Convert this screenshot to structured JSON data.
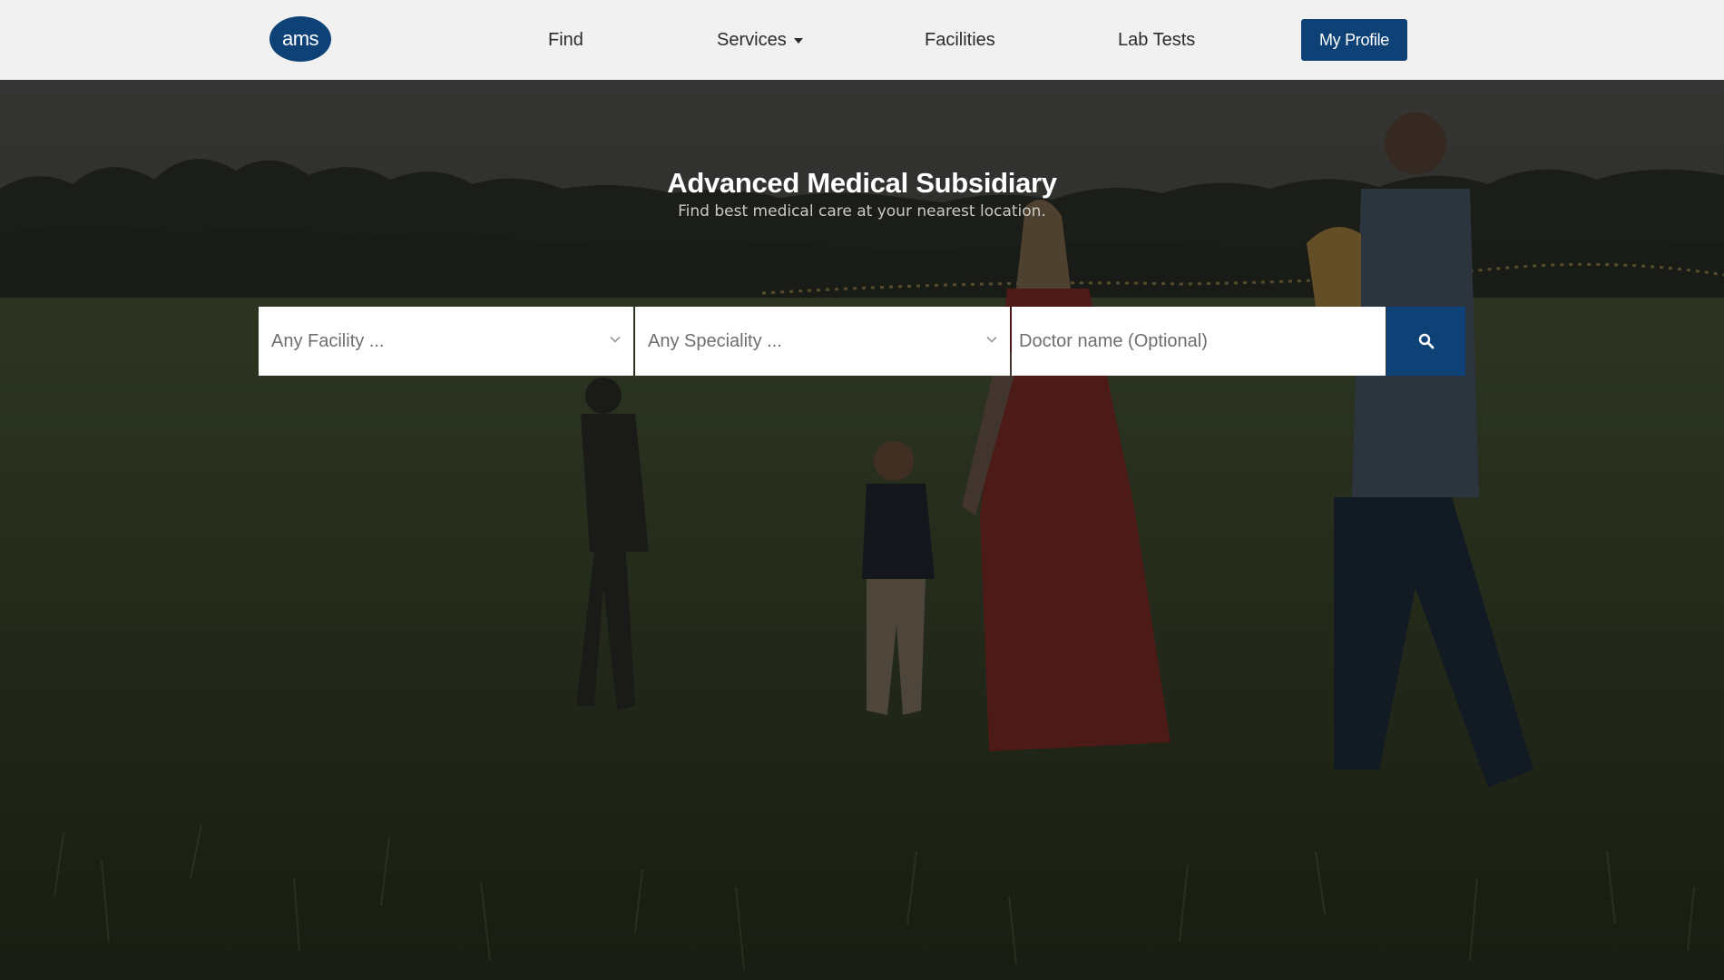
{
  "nav": {
    "logo": "ams",
    "items": [
      {
        "label": "Find"
      },
      {
        "label": "Services"
      },
      {
        "label": "Facilities"
      },
      {
        "label": "Lab Tests"
      }
    ],
    "profile_button": "My Profile"
  },
  "hero": {
    "title": "Advanced Medical Subsidiary",
    "subtitle": "Find best medical care at your nearest location."
  },
  "search": {
    "facility_select": "Any Facility ...",
    "speciality_select": "Any Speciality ...",
    "doctor_placeholder": "Doctor name (Optional)",
    "button_icon": "search-icon"
  },
  "colors": {
    "brand": "#0e4277",
    "navbar_bg": "#f1f1f1",
    "nav_text": "#2b2b2b",
    "hero_title": "#ffffff",
    "hero_subtitle": "#c9c9c9"
  }
}
